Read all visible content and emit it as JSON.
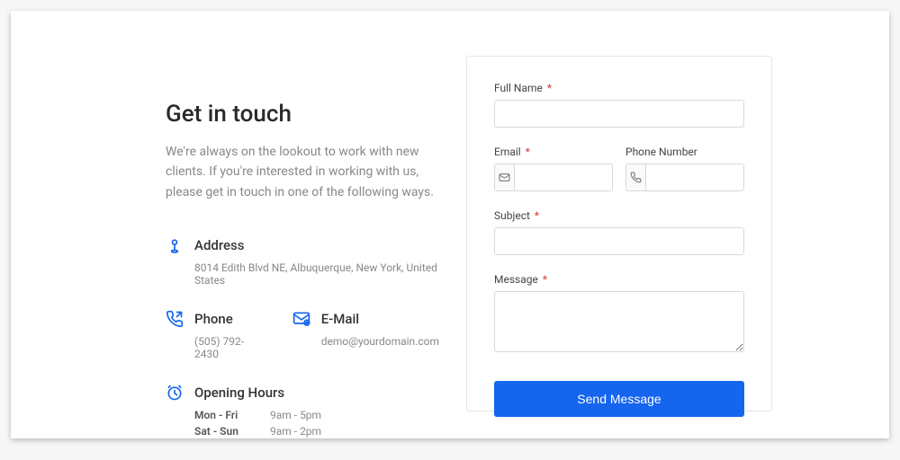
{
  "heading": "Get in touch",
  "intro": "We're always on the lookout to work with new clients. If you're interested in working with us, please get in touch in one of the following ways.",
  "address": {
    "title": "Address",
    "value": "8014 Edith Blvd NE, Albuquerque, New York, United States"
  },
  "phone": {
    "title": "Phone",
    "value": "(505) 792-2430"
  },
  "email": {
    "title": "E-Mail",
    "value": "demo@yourdomain.com"
  },
  "hours": {
    "title": "Opening Hours",
    "rows": [
      {
        "days": "Mon - Fri",
        "times": "9am - 5pm"
      },
      {
        "days": "Sat - Sun",
        "times": "9am - 2pm"
      }
    ]
  },
  "form": {
    "full_name": "Full Name",
    "email": "Email",
    "phone": "Phone Number",
    "subject": "Subject",
    "message": "Message",
    "submit": "Send Message"
  }
}
